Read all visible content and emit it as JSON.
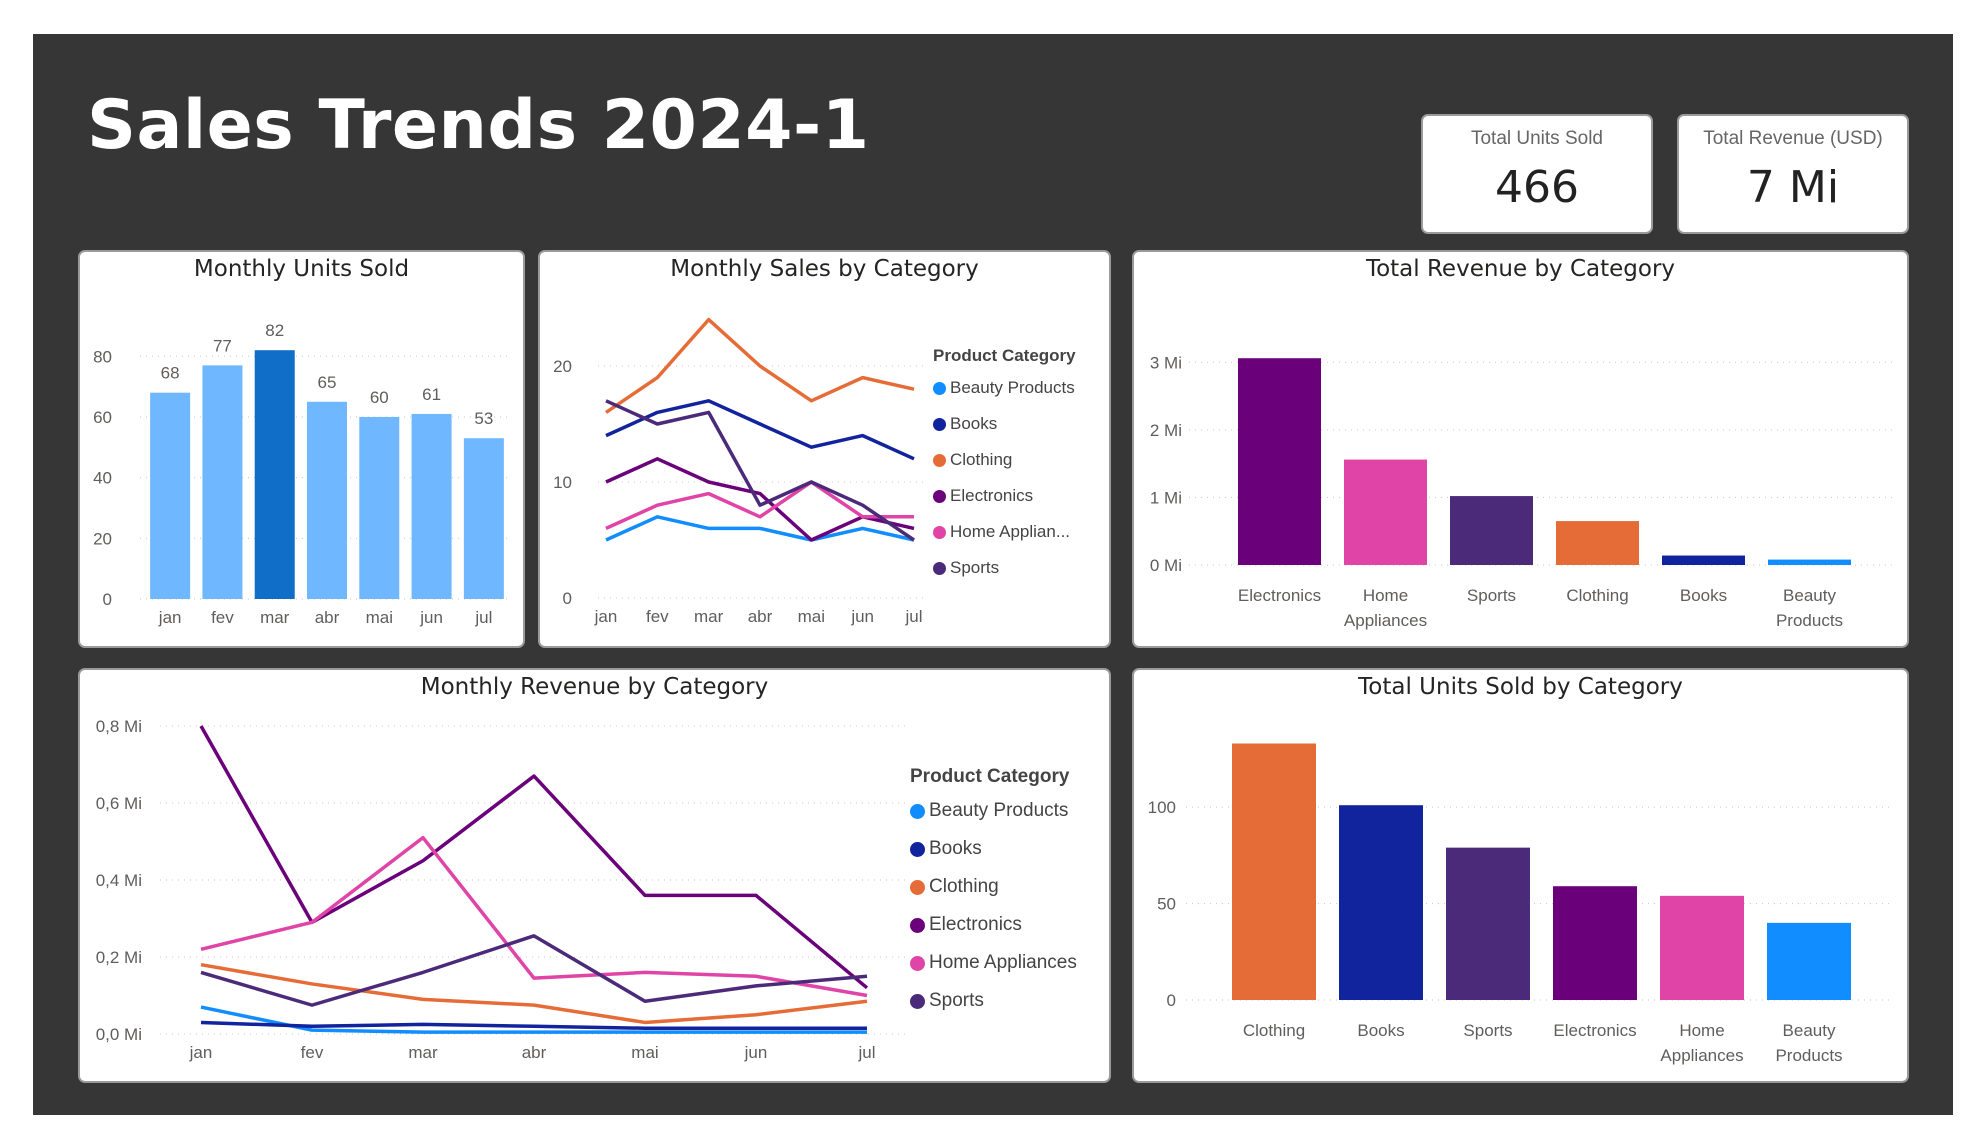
{
  "title": "Sales Trends 2024-1",
  "kpis": [
    {
      "label": "Total Units Sold",
      "value": "466"
    },
    {
      "label": "Total Revenue (USD)",
      "value": "7 Mi"
    }
  ],
  "colors": {
    "Beauty Products": "#118dff",
    "Books": "#12239e",
    "Clothing": "#e66c37",
    "Electronics": "#6b007b",
    "Home Appliances": "#e044a7",
    "Sports": "#4b2a7a",
    "bar_light": "#6fb8ff",
    "bar_highlight": "#106ec8"
  },
  "legend": {
    "title": "Product Category",
    "items_small": [
      "Beauty Products",
      "Books",
      "Clothing",
      "Electronics",
      "Home Applian...",
      "Sports"
    ],
    "items_large": [
      "Beauty Products",
      "Books",
      "Clothing",
      "Electronics",
      "Home Appliances",
      "Sports"
    ]
  },
  "chart_data": [
    {
      "type": "bar",
      "title": "Monthly Units Sold",
      "categories": [
        "jan",
        "fev",
        "mar",
        "abr",
        "mai",
        "jun",
        "jul"
      ],
      "values": [
        68,
        77,
        82,
        65,
        60,
        61,
        53
      ],
      "highlight_index": 2,
      "yticks": [
        "0",
        "20",
        "40",
        "60",
        "80"
      ],
      "ylim": [
        0,
        88
      ]
    },
    {
      "type": "line",
      "title": "Monthly Sales by Category",
      "categories": [
        "jan",
        "fev",
        "mar",
        "abr",
        "mai",
        "jun",
        "jul"
      ],
      "yticks": [
        "0",
        "10",
        "20"
      ],
      "ylim": [
        0,
        25
      ],
      "series": [
        {
          "name": "Beauty Products",
          "values": [
            5,
            7,
            6,
            6,
            5,
            6,
            5
          ]
        },
        {
          "name": "Books",
          "values": [
            14,
            16,
            17,
            15,
            13,
            14,
            12
          ]
        },
        {
          "name": "Clothing",
          "values": [
            16,
            19,
            24,
            20,
            17,
            19,
            18
          ]
        },
        {
          "name": "Electronics",
          "values": [
            10,
            12,
            10,
            9,
            5,
            7,
            6
          ]
        },
        {
          "name": "Home Appliances",
          "values": [
            6,
            8,
            9,
            7,
            10,
            7,
            7
          ]
        },
        {
          "name": "Sports",
          "values": [
            17,
            15,
            16,
            8,
            10,
            8,
            5
          ]
        }
      ]
    },
    {
      "type": "bar",
      "title": "Total Revenue by Category",
      "categories": [
        "Electronics",
        "Home Appliances",
        "Sports",
        "Clothing",
        "Books",
        "Beauty Products"
      ],
      "category_lines": [
        [
          "Electronics"
        ],
        [
          "Home",
          "Appliances"
        ],
        [
          "Sports"
        ],
        [
          "Clothing"
        ],
        [
          "Books"
        ],
        [
          "Beauty",
          "Products"
        ]
      ],
      "values": [
        3.06,
        1.56,
        1.02,
        0.65,
        0.14,
        0.08
      ],
      "unit": "Mi",
      "yticks": [
        "0 Mi",
        "1 Mi",
        "2 Mi",
        "3 Mi"
      ],
      "ylim": [
        0,
        3.3
      ]
    },
    {
      "type": "line",
      "title": "Monthly Revenue by Category",
      "categories": [
        "jan",
        "fev",
        "mar",
        "abr",
        "mai",
        "jun",
        "jul"
      ],
      "unit": "Mi",
      "yticks": [
        "0,0 Mi",
        "0,2 Mi",
        "0,4 Mi",
        "0,6 Mi",
        "0,8 Mi"
      ],
      "ylim": [
        0,
        0.8
      ],
      "series": [
        {
          "name": "Beauty Products",
          "values": [
            0.07,
            0.01,
            0.005,
            0.005,
            0.005,
            0.005,
            0.005
          ]
        },
        {
          "name": "Books",
          "values": [
            0.03,
            0.02,
            0.025,
            0.02,
            0.015,
            0.015,
            0.015
          ]
        },
        {
          "name": "Clothing",
          "values": [
            0.18,
            0.13,
            0.09,
            0.075,
            0.03,
            0.05,
            0.085
          ]
        },
        {
          "name": "Electronics",
          "values": [
            0.8,
            0.29,
            0.45,
            0.67,
            0.36,
            0.36,
            0.12
          ]
        },
        {
          "name": "Home Appliances",
          "values": [
            0.22,
            0.29,
            0.51,
            0.145,
            0.16,
            0.15,
            0.1
          ]
        },
        {
          "name": "Sports",
          "values": [
            0.16,
            0.075,
            0.16,
            0.255,
            0.085,
            0.125,
            0.15
          ]
        }
      ]
    },
    {
      "type": "bar",
      "title": "Total Units Sold by Category",
      "categories": [
        "Clothing",
        "Books",
        "Sports",
        "Electronics",
        "Home Appliances",
        "Beauty Products"
      ],
      "category_lines": [
        [
          "Clothing"
        ],
        [
          "Books"
        ],
        [
          "Sports"
        ],
        [
          "Electronics"
        ],
        [
          "Home",
          "Appliances"
        ],
        [
          "Beauty",
          "Products"
        ]
      ],
      "values": [
        133,
        101,
        79,
        59,
        54,
        40
      ],
      "yticks": [
        "0",
        "50",
        "100"
      ],
      "ylim": [
        0,
        140
      ]
    }
  ]
}
